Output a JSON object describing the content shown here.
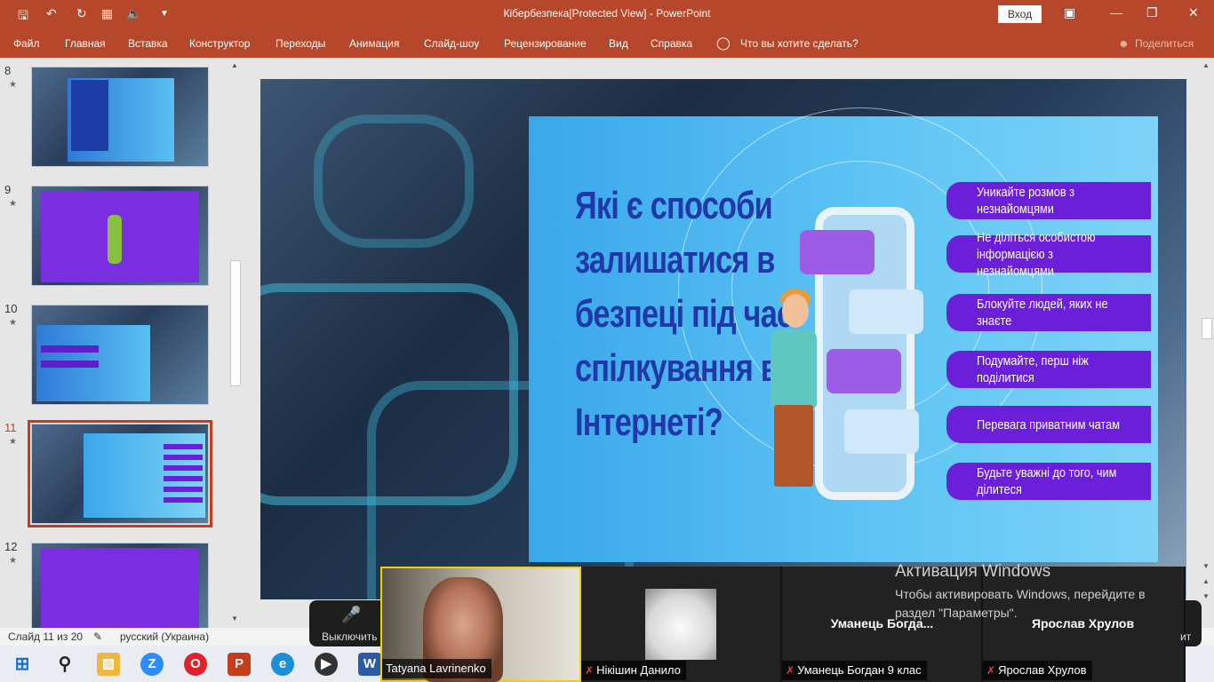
{
  "titlebar": {
    "title": "Кібербезпека[Protected View]  -  PowerPoint",
    "login_label": "Вход",
    "icons": [
      "save-icon",
      "undo-icon",
      "redo-icon",
      "present-icon",
      "volume-icon",
      "customize-icon"
    ]
  },
  "ribbon": {
    "tabs": [
      "Файл",
      "Главная",
      "Вставка",
      "Конструктор",
      "Переходы",
      "Анимация",
      "Слайд-шоу",
      "Рецензирование",
      "Вид",
      "Справка"
    ],
    "tell_me": "Что вы хотите сделать?",
    "share": "Поделиться"
  },
  "thumbnails": [
    {
      "num": "8",
      "star": "★"
    },
    {
      "num": "9",
      "star": "★"
    },
    {
      "num": "10",
      "star": "★"
    },
    {
      "num": "11",
      "star": "★"
    },
    {
      "num": "12",
      "star": "★"
    }
  ],
  "slide": {
    "heading": "Які є способи\nзалишатися в\nбезпеці під час\nспілкування в\nІнтернеті?",
    "tips": [
      "Уникайте розмов з незнайомцями",
      "Не діліться особистою інформацією з незнайомцями",
      "Блокуйте людей, яких не знаєте",
      "Подумайте, перш ніж поділитися",
      "Перевага приватним чатам",
      "Будьте уважні до того, чим ділитеся"
    ]
  },
  "statusbar": {
    "slide_info": "Слайд 11 из 20",
    "language": "русский (Украина)"
  },
  "activation": {
    "title": "Активация Windows",
    "text": "Чтобы активировать Windows, перейдите в раздел \"Параметры\"."
  },
  "zoom": {
    "mute_label": "Выключить",
    "participants": [
      {
        "name": "Tatyana Lavrinenko",
        "display": ""
      },
      {
        "name": "Нікішин Данило",
        "display": ""
      },
      {
        "name": "Уманець Богдан 9 клас",
        "display": "Уманець  Богда..."
      },
      {
        "name": "Ярослав Хрулов",
        "display": "Ярослав Хрулов"
      }
    ],
    "extra": "ит"
  },
  "colors": {
    "accent": "#b7472a",
    "selection": "#c43e1c",
    "tip_pill": "#6b1fd8",
    "heading": "#2038a8"
  }
}
